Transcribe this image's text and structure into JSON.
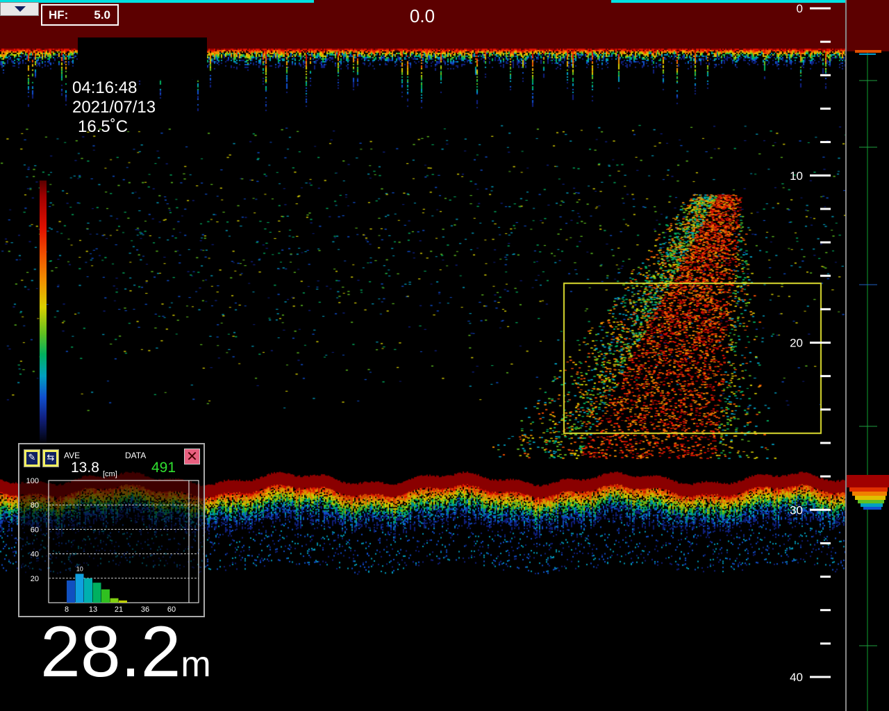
{
  "status_bar": {
    "accent_color": "#00e0e0"
  },
  "menu": {
    "icon": "dropdown-triangle-icon"
  },
  "frequency": {
    "label": "HF:",
    "gain": "5.0"
  },
  "top_center_value": "0.0",
  "info": {
    "time": "04:16:48",
    "date": "2021/07/13",
    "temperature": "16.5˚C"
  },
  "histogram_panel": {
    "settings_icon": "wrench-icon",
    "swap_icon": "swap-arrows-icon",
    "close_icon": "close-icon",
    "ave_label": "AVE",
    "ave_value": "13.8",
    "ave_unit": "[cm]",
    "data_label": "DATA",
    "data_value": "491",
    "chart_data": {
      "type": "bar",
      "y_ticks": [
        "100",
        "80",
        "60",
        "40",
        "20"
      ],
      "ylim": [
        0,
        100
      ],
      "x_ticks": [
        "8",
        "13",
        "21",
        "36",
        "60"
      ],
      "peak_label": "10",
      "values": [
        10,
        13,
        11,
        9,
        6,
        2,
        1
      ],
      "colors": [
        "#1050c0",
        "#10a0e0",
        "#00b0b0",
        "#00b060",
        "#30c020",
        "#80d010",
        "#c0d000"
      ],
      "grid": true
    }
  },
  "depth": {
    "value": "28.2",
    "unit": "m"
  },
  "depth_scale": {
    "labels": [
      "0",
      "10",
      "20",
      "30",
      "40"
    ],
    "range": [
      0,
      40
    ],
    "minor_step": 2
  },
  "selection_box": {
    "color": "#e0e030"
  }
}
